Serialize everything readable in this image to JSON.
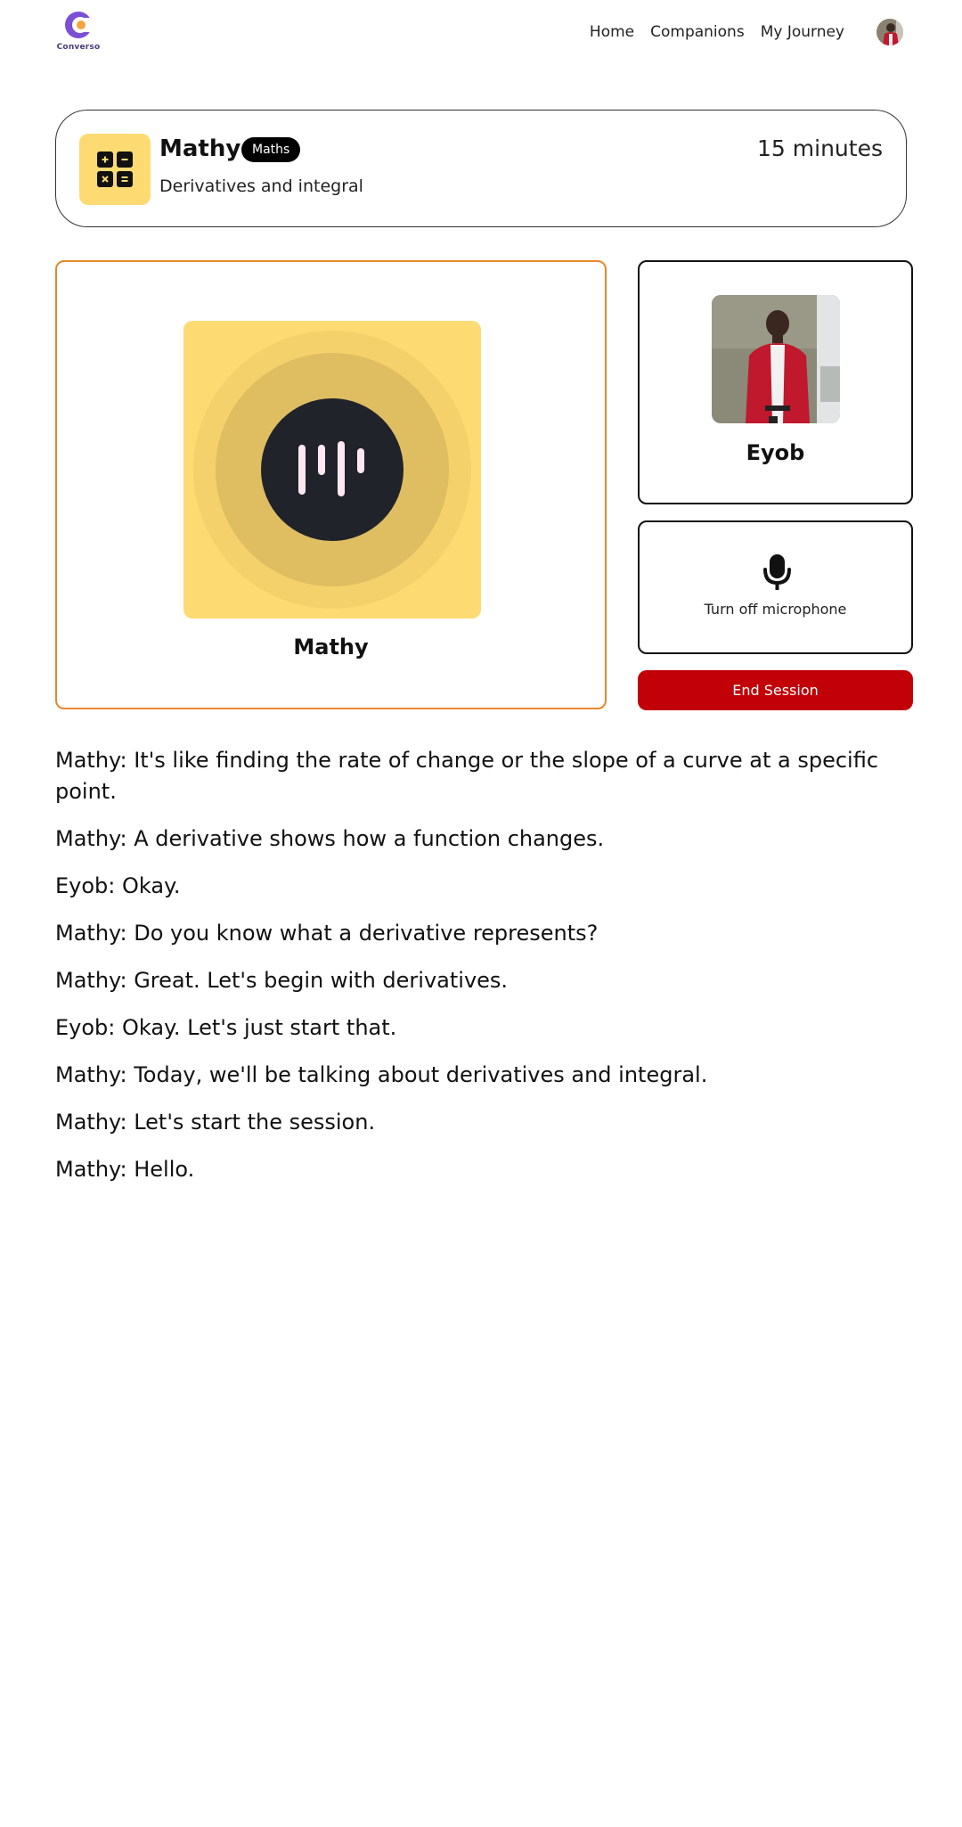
{
  "brand": {
    "logo_text": "Converso"
  },
  "nav": {
    "links": [
      "Home",
      "Companions",
      "My Journey"
    ]
  },
  "session": {
    "companion_name": "Mathy",
    "subject": "Maths",
    "topic": "Derivatives and integral",
    "duration": "15 minutes"
  },
  "user": {
    "name": "Eyob"
  },
  "controls": {
    "mic_label": "Turn off microphone",
    "end_label": "End Session"
  },
  "colors": {
    "accent_orange": "#e8872e",
    "subject_yellow": "#fedb72",
    "end_red": "#c10007",
    "brand_purple": "#7b4fd6"
  },
  "transcript": [
    "Mathy: It's like finding the rate of change or the slope of a curve at a specific point.",
    "Mathy: A derivative shows how a function changes.",
    "Eyob: Okay.",
    "Mathy: Do you know what a derivative represents?",
    "Mathy: Great. Let's begin with derivatives.",
    "Eyob: Okay. Let's just start that.",
    "Mathy: Today, we'll be talking about derivatives and integral.",
    "Mathy: Let's start the session.",
    "Mathy: Hello."
  ]
}
